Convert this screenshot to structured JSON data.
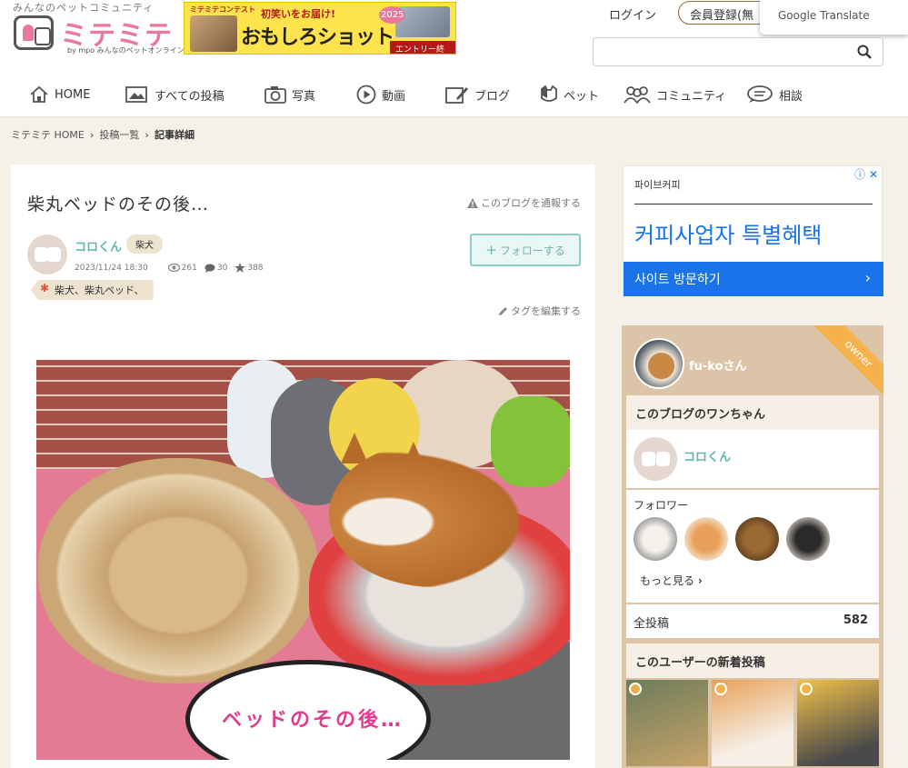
{
  "header": {
    "tagline": "みんなのペットコミュニティ",
    "logo": "ミテミテ",
    "logo_sub": "by mpo みんなのペットオンライン",
    "banner": {
      "top": "ミテミテコンテスト",
      "sub": "初笑いをお届け!",
      "main": "おもしろショット",
      "year": "2025",
      "status": "エントリー終了"
    },
    "login": "ログイン",
    "register": "会員登録(無",
    "translate_popup": "Google Translate",
    "search_placeholder": ""
  },
  "nav": [
    {
      "label": "HOME",
      "icon": "home-icon"
    },
    {
      "label": "すべての投稿",
      "icon": "posts-icon"
    },
    {
      "label": "写真",
      "icon": "camera-icon"
    },
    {
      "label": "動画",
      "icon": "play-icon"
    },
    {
      "label": "ブログ",
      "icon": "blog-icon"
    },
    {
      "label": "ペット",
      "icon": "pet-icon"
    },
    {
      "label": "コミュニティ",
      "icon": "community-icon"
    },
    {
      "label": "相談",
      "icon": "chat-icon"
    }
  ],
  "breadcrumb": [
    "ミテミテ HOME",
    "投稿一覧",
    "記事詳細"
  ],
  "post": {
    "title": "柴丸ベッドのその後…",
    "report": "このブログを通報する",
    "author": "コロくん",
    "breed": "柴犬",
    "date": "2023/11/24 18:30",
    "views": "261",
    "comments": "30",
    "likes": "388",
    "follow": "フォローする",
    "tags": "柴犬、柴丸ベッド、",
    "edit_tags": "タグを編集する",
    "image_caption": "ベッドのその後…"
  },
  "ad": {
    "brand": "파이브커피",
    "headline": "커피사업자 특별혜택",
    "cta": "사이트 방문하기",
    "icons": "ⓘ ✕"
  },
  "sidebar": {
    "ribbon": "owner",
    "username": "fu-koさん",
    "dog_section": "このブログのワンちゃん",
    "dog_name": "コロくん",
    "followers_label": "フォロワー",
    "more": "もっと見る",
    "total_label": "全投稿",
    "total_value": "582",
    "new_posts": "このユーザーの新着投稿"
  },
  "colors": {
    "accent_teal": "#5fb6a8",
    "pink": "#e9799b",
    "sidebar_bg": "#dcc4a8",
    "page_bg": "#f5f0e8",
    "ad_blue": "#1a73e8"
  }
}
